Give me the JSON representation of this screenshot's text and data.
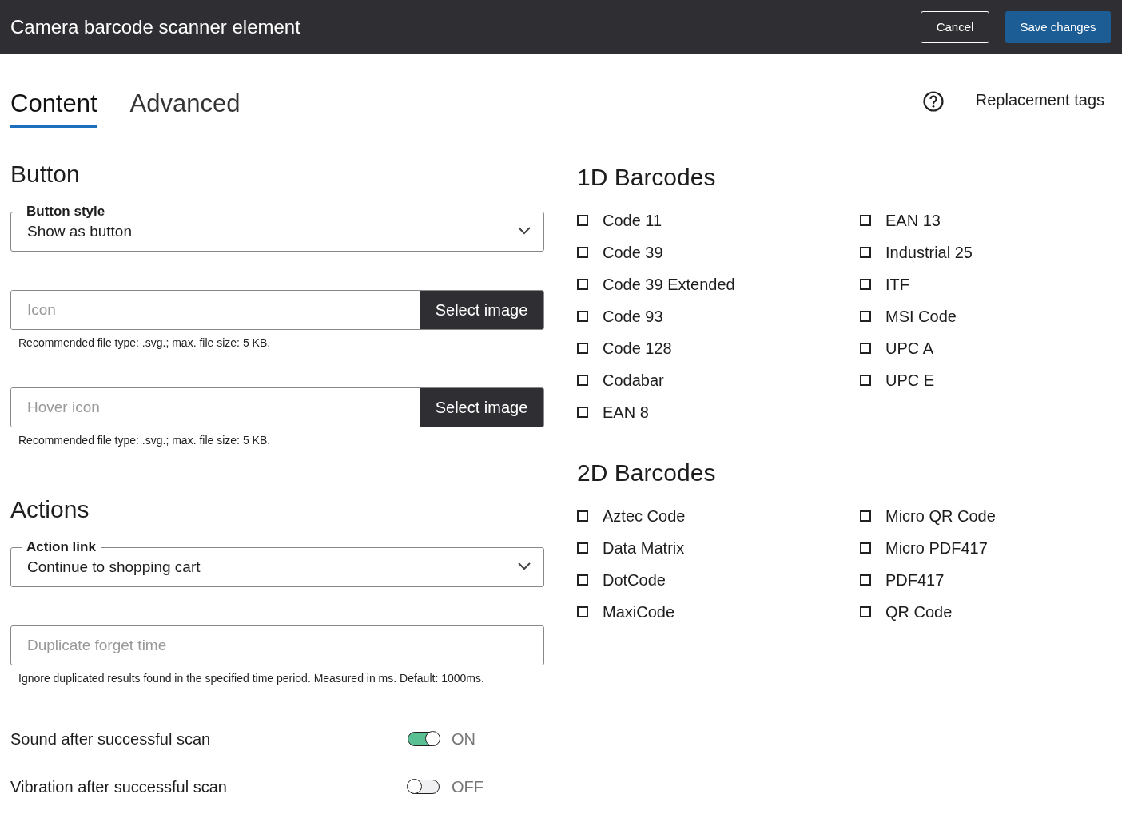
{
  "header": {
    "title": "Camera barcode scanner element",
    "buttons": [
      {
        "label": "Cancel",
        "kind": "outline"
      },
      {
        "label": "Save changes",
        "kind": "primary"
      }
    ]
  },
  "tabs": [
    {
      "label": "Content",
      "selected": true
    },
    {
      "label": "Advanced",
      "selected": false
    }
  ],
  "replacement_tags": {
    "label": "Replacement tags"
  },
  "sections": [
    {
      "title": "Button",
      "fields": [
        {
          "kind": "select",
          "label": "Button style",
          "value": "Show as button"
        },
        {
          "kind": "file",
          "placeholder": "Icon",
          "button": "Select image",
          "help": "Recommended file type: .svg.; max. file size: 5 KB."
        },
        {
          "kind": "file",
          "placeholder": "Hover icon",
          "button": "Select image",
          "help": "Recommended file type: .svg.; max. file size: 5 KB."
        }
      ]
    },
    {
      "title": "Actions",
      "fields": [
        {
          "kind": "select",
          "label": "Action link",
          "value": "Continue to shopping cart"
        },
        {
          "kind": "text",
          "placeholder": "Duplicate forget time",
          "help": "Ignore duplicated results found in the specified time period. Measured in ms. Default: 1000ms."
        },
        {
          "kind": "toggle",
          "label": "Sound after successful scan",
          "on": true,
          "state": "ON"
        },
        {
          "kind": "toggle",
          "label": "Vibration after successful scan",
          "on": false,
          "state": "OFF"
        }
      ]
    }
  ],
  "barcode_groups": [
    {
      "title": "1D Barcodes",
      "items": [
        {
          "label": "Code 11",
          "checked": false
        },
        {
          "label": "Code 39",
          "checked": false
        },
        {
          "label": "Code 39 Extended",
          "checked": false
        },
        {
          "label": "Code 93",
          "checked": false
        },
        {
          "label": "Code 128",
          "checked": false
        },
        {
          "label": "Codabar",
          "checked": false
        },
        {
          "label": "EAN 8",
          "checked": false
        },
        {
          "label": "EAN 13",
          "checked": false
        },
        {
          "label": "Industrial 25",
          "checked": false
        },
        {
          "label": "ITF",
          "checked": false
        },
        {
          "label": "MSI Code",
          "checked": false
        },
        {
          "label": "UPC A",
          "checked": false
        },
        {
          "label": "UPC E",
          "checked": false
        }
      ]
    },
    {
      "title": "2D Barcodes",
      "items": [
        {
          "label": "Aztec Code",
          "checked": false
        },
        {
          "label": "Data Matrix",
          "checked": false
        },
        {
          "label": "DotCode",
          "checked": false
        },
        {
          "label": "MaxiCode",
          "checked": false
        },
        {
          "label": "Micro QR Code",
          "checked": false
        },
        {
          "label": "Micro PDF417",
          "checked": false
        },
        {
          "label": "PDF417",
          "checked": false
        },
        {
          "label": "QR Code",
          "checked": false
        }
      ]
    }
  ]
}
